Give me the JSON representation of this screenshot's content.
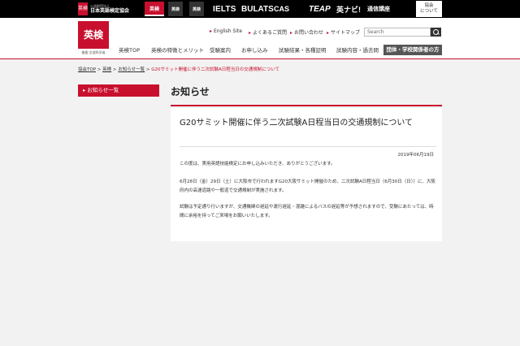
{
  "topbar": {
    "org_small": "公益財団法人",
    "org_name": "日本英語検定協会",
    "org_logo": "英検",
    "brands": [
      "英検",
      "英検",
      "英検",
      "IELTS",
      "BULATS",
      "CAS",
      "TEAP",
      "英ナビ!"
    ],
    "tsushin": "通信講座",
    "about_line1": "協会",
    "about_line2": "について"
  },
  "header": {
    "logo_text": "英検",
    "logo_sub": "後援:文部科学省",
    "util_links": [
      "English Site",
      "よくあるご質問",
      "お問い合わせ",
      "サイトマップ"
    ],
    "search_placeholder": "Search",
    "nav": [
      "英検TOP",
      "英検の特徴とメリット",
      "受験案内",
      "お申し込み",
      "試験結果・各種証明",
      "試験内容・過去問"
    ],
    "nav_special": "団体・学校関係者の方"
  },
  "breadcrumb": {
    "items": [
      "協会TOP",
      "英検",
      "お知らせ一覧"
    ],
    "current": "G20サミット開催に伴う二次試験A日程当日の交通規制について",
    "sep": ">"
  },
  "sidebar": {
    "button": "お知らせ一覧"
  },
  "main": {
    "heading": "お知らせ",
    "article_title": "G20サミット開催に伴う二次試験A日程当日の交通規制について",
    "date": "2019年06月19日",
    "paragraphs": [
      "この度は、実用英語技能検定にお申し込みいただき、ありがとうございます。",
      "6月28日（金）29日（土）に大阪市で行われますG20大阪サミット開催のため、二次試験A日程当日（6月30日（日））に、大阪府内の高速道路や一般道で交通規制が実施されます。",
      "試験は予定通り行いますが、交通機関の遅延や運行遅延・混雑によるバスの遅延等が予想されますので、受験にあたっては、時間に余裕を持ってご来場をお願いいたします。"
    ]
  },
  "colors": {
    "brand_red": "#c8102e",
    "topbar": "#000000",
    "background": "#f2f2f2"
  }
}
